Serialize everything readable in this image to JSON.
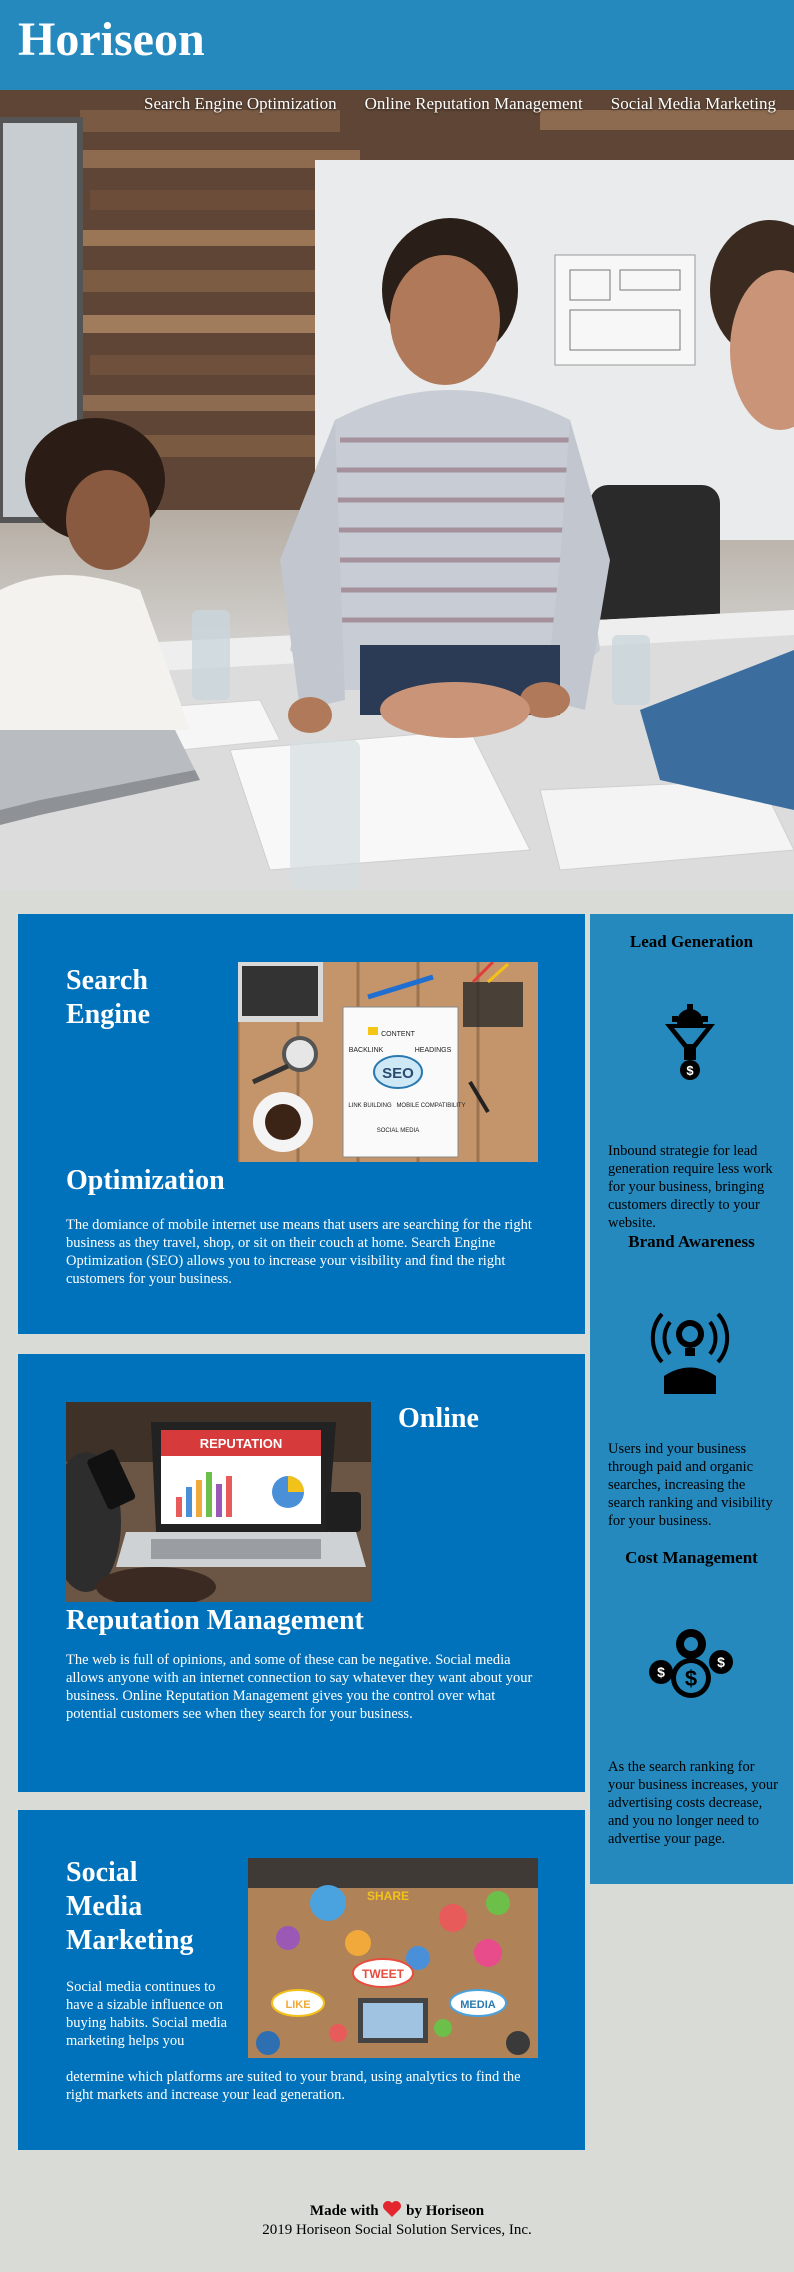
{
  "header": {
    "logo": "Horiseon",
    "nav": [
      "Search Engine Optimization",
      "Online Reputation Management",
      "Social Media Marketing"
    ],
    "brand_color": "#2589bd"
  },
  "cards": {
    "seo": {
      "title_line1": "Search",
      "title_line2": "Engine",
      "title_line3": "Optimization",
      "text": "The domiance of mobile internet use means that users are searching for the right business as they travel, shop, or sit on their couch at home. Search Engine Optimization (SEO) allows you to increase your visibility and find the right customers for your business.",
      "image_label": "SEO",
      "image_words": [
        "CONTENT",
        "BACKLINK",
        "HEADINGS",
        "LINK BUILDING",
        "MOBILE COMPATIBILITY",
        "SOCIAL MEDIA"
      ]
    },
    "orm": {
      "title_line1": "Online",
      "title_line2": "Reputation Management",
      "text": "The web is full of opinions, and some of these can be negative. Social media allows anyone with an internet connection to say whatever they want about your business. Online Reputation Management gives you the control over what potential customers see when they search for your business.",
      "image_label": "REPUTATION"
    },
    "smm": {
      "title_line1": "Social",
      "title_line2": "Media",
      "title_line3": "Marketing",
      "text_narrow": "Social media continues to have a sizable influence on buying habits. Social media marketing helps you",
      "text_wide": "determine which platforms are suited to your brand, using analytics to find the right markets and increase your lead generation.",
      "image_words": [
        "SHARE",
        "TWEET",
        "LIKE",
        "MEDIA"
      ]
    },
    "card_color": "#0072bb"
  },
  "sidebar": {
    "lead": {
      "title": "Lead Generation",
      "text": "Inbound strategie for lead generation require less work for your business, bringing customers directly to your website."
    },
    "brand": {
      "title": "Brand Awareness",
      "text": "Users ind your business through paid and organic searches, increasing the search ranking and visibility for your business."
    },
    "cost": {
      "title": "Cost Management",
      "text": "As the search ranking for your business increases, your advertising costs decrease, and you no longer need to advertise your page."
    }
  },
  "footer": {
    "made_prefix": "Made with",
    "made_suffix": "by Horiseon",
    "copyright": "2019 Horiseon Social Solution Services, Inc."
  },
  "page_background": "#d9dcd6"
}
